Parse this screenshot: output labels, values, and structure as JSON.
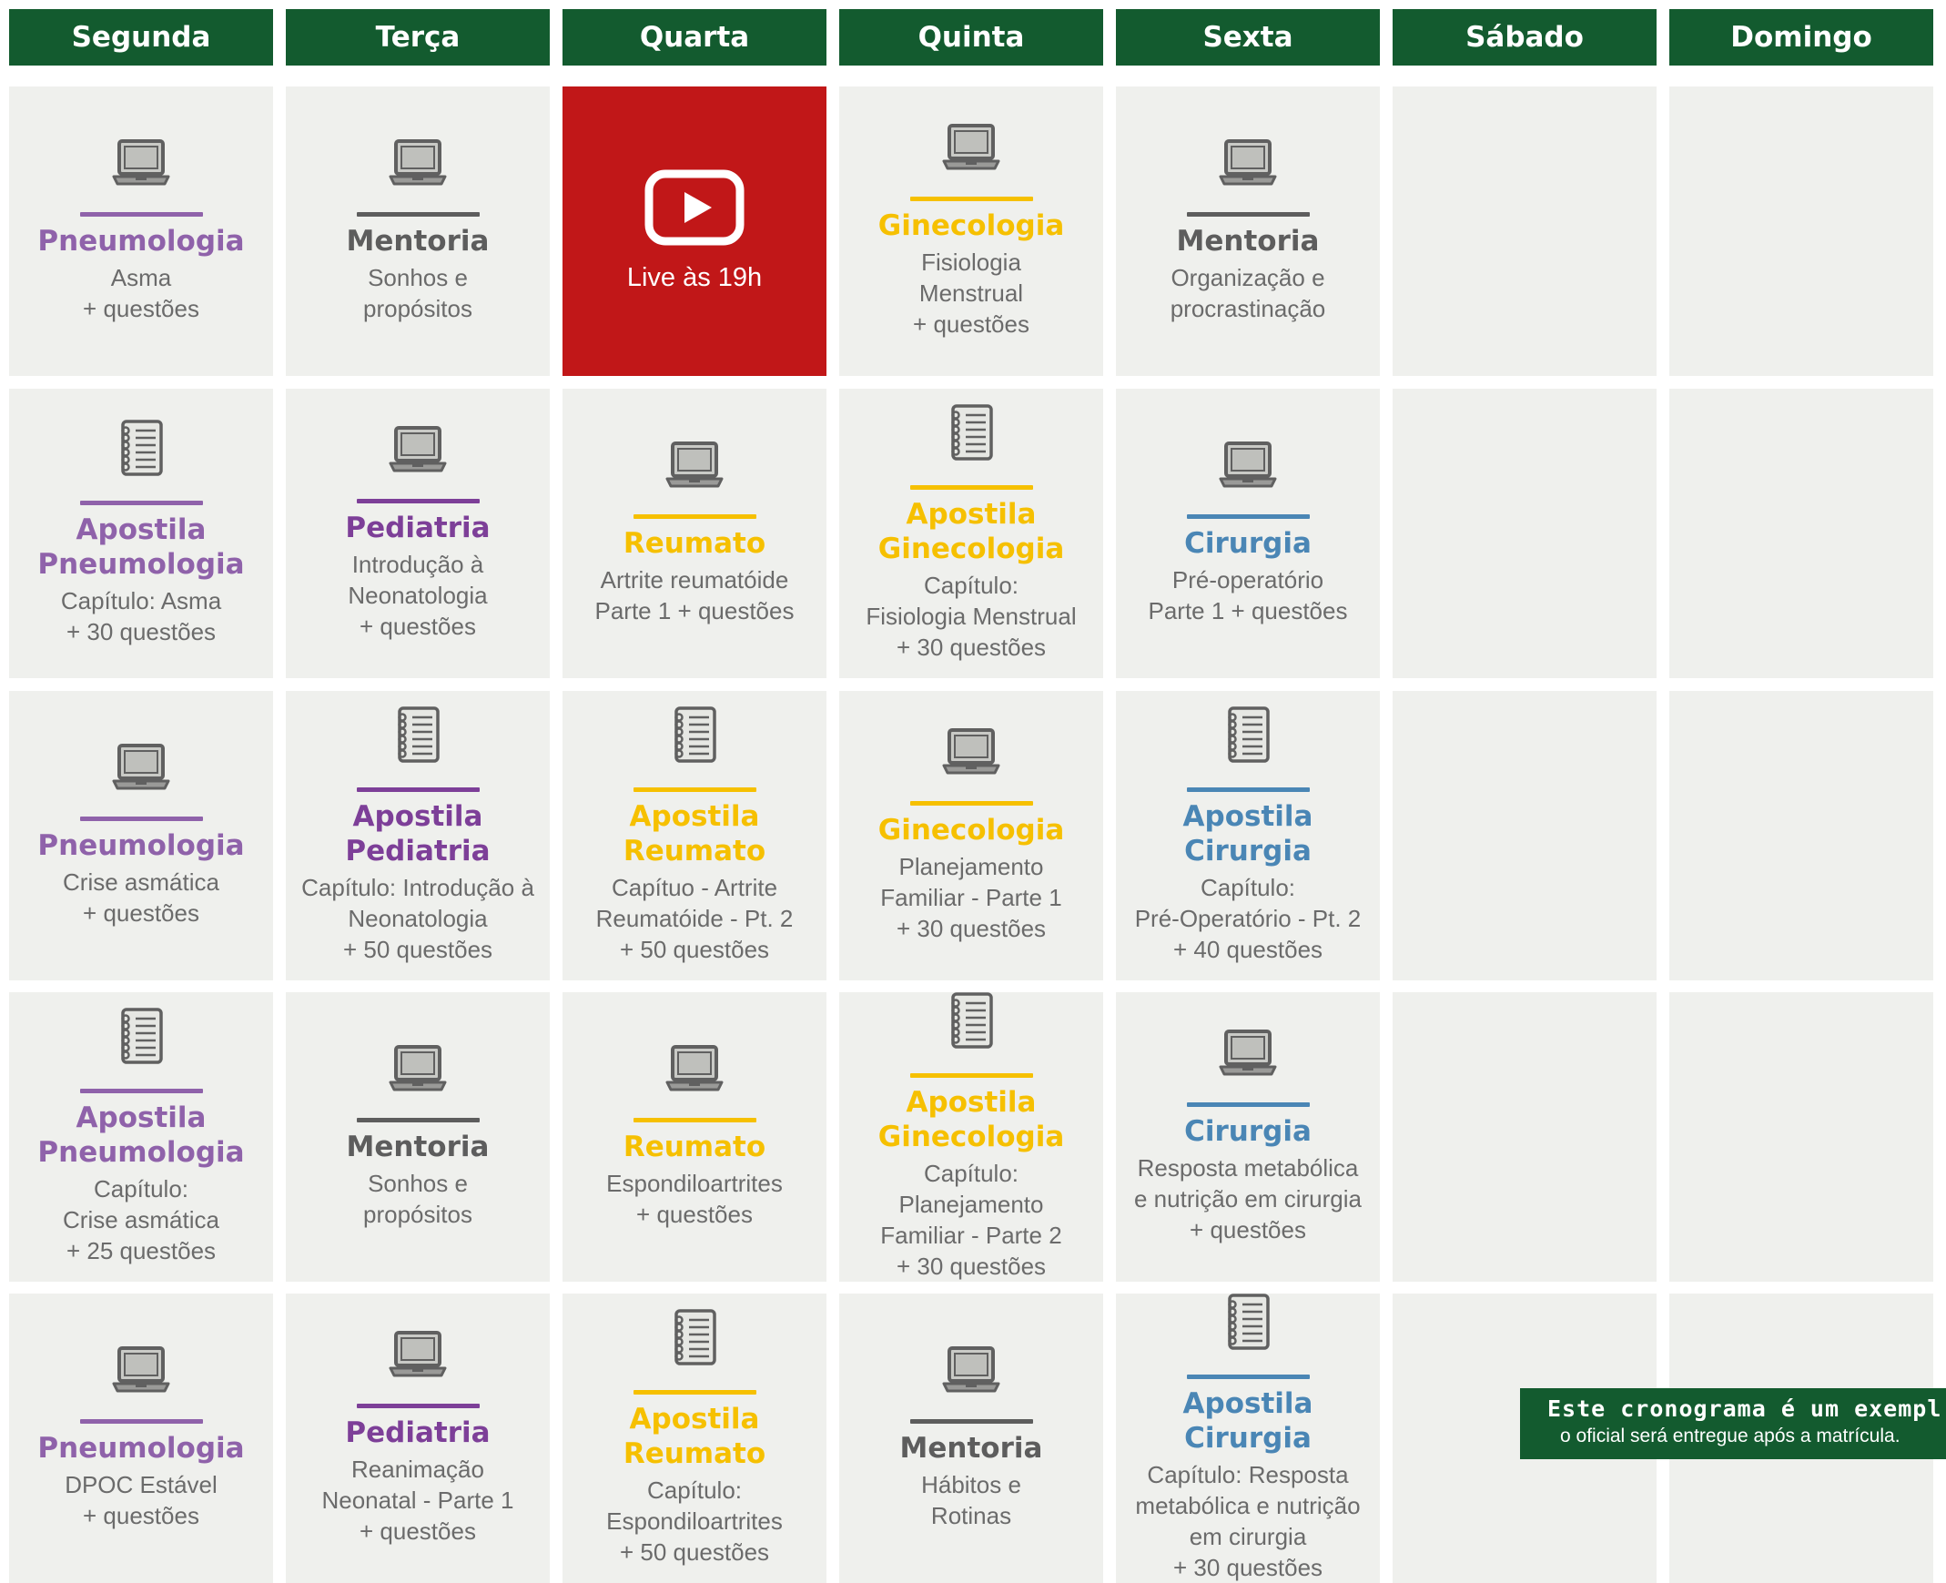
{
  "days": [
    "Segunda",
    "Terça",
    "Quarta",
    "Quinta",
    "Sexta",
    "Sábado",
    "Domingo"
  ],
  "colors": {
    "header_green": "#135b2f",
    "cell_bg": "#eff0ed",
    "live_red": "#c11718",
    "pneumologia_purple": "#8f62aa",
    "pediatria_purple": "#7d3f98",
    "mentoria_gray": "#5d5d5d",
    "gineco_reumato_yellow": "#f6c000",
    "cirurgia_blue": "#4a86b5"
  },
  "rows": [
    [
      {
        "icon": "laptop-icon",
        "color": "purple",
        "title": "Pneumologia",
        "sub": "Asma\n+ questões"
      },
      {
        "icon": "laptop-icon",
        "color": "gray",
        "title": "Mentoria",
        "sub": "Sonhos e\npropósitos"
      },
      {
        "icon": "youtube-play-icon",
        "live": true,
        "label": "Live às 19h"
      },
      {
        "icon": "laptop-icon",
        "color": "yellow",
        "title": "Ginecologia",
        "sub": "Fisiologia\nMenstrual\n+ questões"
      },
      {
        "icon": "laptop-icon",
        "color": "gray",
        "title": "Mentoria",
        "sub": "Organização e\nprocrastinação"
      },
      {
        "empty": true
      },
      {
        "empty": true
      }
    ],
    [
      {
        "icon": "notebook-icon",
        "color": "purple",
        "title": "Apostila\nPneumologia",
        "sub": "Capítulo: Asma\n+ 30 questões"
      },
      {
        "icon": "laptop-icon",
        "color": "dpurple",
        "title": "Pediatria",
        "sub": "Introdução à\nNeonatologia\n+ questões"
      },
      {
        "icon": "laptop-icon",
        "color": "yellow",
        "title": "Reumato",
        "sub": "Artrite reumatóide\nParte 1 + questões"
      },
      {
        "icon": "notebook-icon",
        "color": "yellow",
        "title": "Apostila\nGinecologia",
        "sub": "Capítulo:\nFisiologia Menstrual\n+ 30 questões"
      },
      {
        "icon": "laptop-icon",
        "color": "blue",
        "title": "Cirurgia",
        "sub": "Pré-operatório\nParte 1 + questões"
      },
      {
        "empty": true
      },
      {
        "empty": true
      }
    ],
    [
      {
        "icon": "laptop-icon",
        "color": "purple",
        "title": "Pneumologia",
        "sub": "Crise asmática\n+ questões"
      },
      {
        "icon": "notebook-icon",
        "color": "dpurple",
        "title": "Apostila\nPediatria",
        "sub": "Capítulo: Introdução à\nNeonatologia\n+ 50 questões"
      },
      {
        "icon": "notebook-icon",
        "color": "yellow",
        "title": "Apostila\nReumato",
        "sub": "Capítuo - Artrite\nReumatóide - Pt. 2\n+ 50 questões"
      },
      {
        "icon": "laptop-icon",
        "color": "yellow",
        "title": "Ginecologia",
        "sub": "Planejamento\nFamiliar - Parte 1\n+ 30 questões"
      },
      {
        "icon": "notebook-icon",
        "color": "blue",
        "title": "Apostila\nCirurgia",
        "sub": "Capítulo:\nPré-Operatório - Pt. 2\n+ 40 questões"
      },
      {
        "empty": true
      },
      {
        "empty": true
      }
    ],
    [
      {
        "icon": "notebook-icon",
        "color": "purple",
        "title": "Apostila\nPneumologia",
        "sub": "Capítulo:\nCrise asmática\n+ 25 questões"
      },
      {
        "icon": "laptop-icon",
        "color": "gray",
        "title": "Mentoria",
        "sub": "Sonhos e\npropósitos"
      },
      {
        "icon": "laptop-icon",
        "color": "yellow",
        "title": "Reumato",
        "sub": "Espondiloartrites\n+ questões"
      },
      {
        "icon": "notebook-icon",
        "color": "yellow",
        "title": "Apostila\nGinecologia",
        "sub": "Capítulo:\nPlanejamento\nFamiliar - Parte 2\n+ 30 questões"
      },
      {
        "icon": "laptop-icon",
        "color": "blue",
        "title": "Cirurgia",
        "sub": "Resposta metabólica\ne nutrição em cirurgia\n+ questões"
      },
      {
        "empty": true
      },
      {
        "empty": true
      }
    ],
    [
      {
        "icon": "laptop-icon",
        "color": "purple",
        "title": "Pneumologia",
        "sub": "DPOC Estável\n+ questões"
      },
      {
        "icon": "laptop-icon",
        "color": "dpurple",
        "title": "Pediatria",
        "sub": "Reanimação\nNeonatal - Parte 1\n+ questões"
      },
      {
        "icon": "notebook-icon",
        "color": "yellow",
        "title": "Apostila\nReumato",
        "sub": "Capítulo:\nEspondiloartrites\n+ 50 questões"
      },
      {
        "icon": "laptop-icon",
        "color": "gray",
        "title": "Mentoria",
        "sub": "Hábitos e\nRotinas"
      },
      {
        "icon": "notebook-icon",
        "color": "blue",
        "title": "Apostila\nCirurgia",
        "sub": "Capítulo: Resposta\nmetabólica e nutrição\nem cirurgia\n+ 30 questões"
      },
      {
        "empty": true
      },
      {
        "empty": true
      }
    ]
  ],
  "note": {
    "line1": "Este cronograma é um exempl",
    "line2": "o oficial será entregue após a matrícula."
  }
}
